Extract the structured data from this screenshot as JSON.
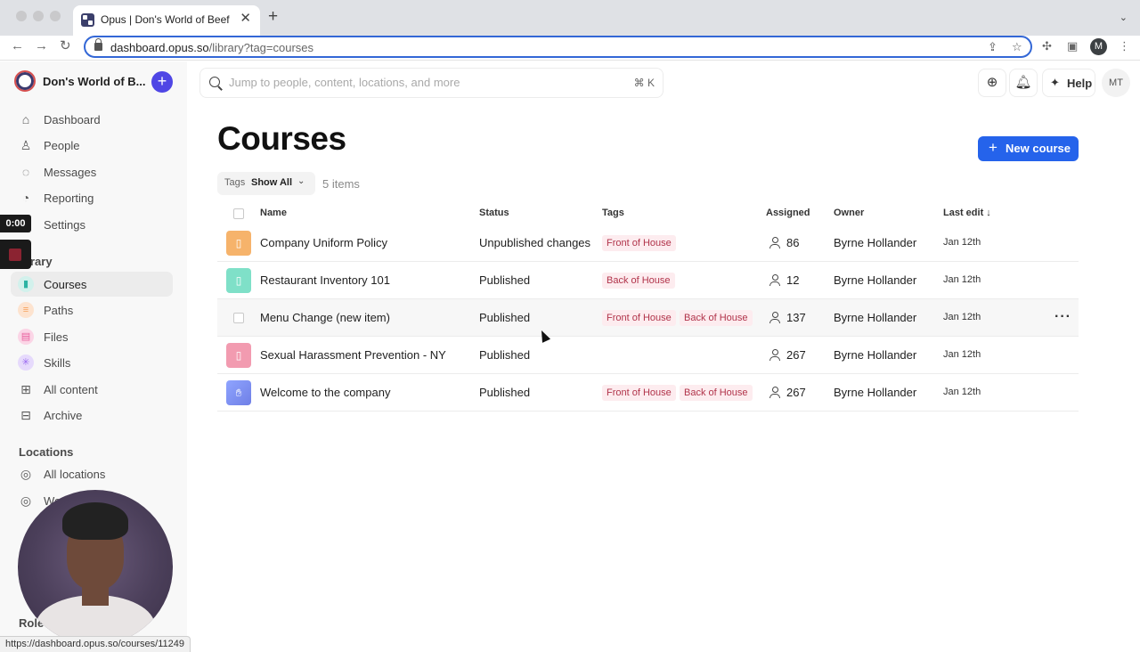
{
  "browser": {
    "tab_title": "Opus | Don's World of Beef",
    "url_host": "dashboard.opus.so",
    "url_path": "/library?tag=courses",
    "profile_initial": "M",
    "status_url": "https://dashboard.opus.so/courses/11249"
  },
  "sidebar": {
    "workspace_name": "Don's World of B...",
    "nav": [
      {
        "label": "Dashboard",
        "icon": "home-icon"
      },
      {
        "label": "People",
        "icon": "person-icon"
      },
      {
        "label": "Messages",
        "icon": "chat-icon"
      },
      {
        "label": "Reporting",
        "icon": "chart-pie-icon"
      },
      {
        "label": "Settings",
        "icon": "gear-icon"
      }
    ],
    "library_label": "rary",
    "library": [
      {
        "label": "Courses",
        "icon": "bookmark-icon",
        "color": "#2bb3a3",
        "active": true
      },
      {
        "label": "Paths",
        "icon": "paths-icon",
        "color": "#f5a15b"
      },
      {
        "label": "Files",
        "icon": "file-icon",
        "color": "#e85d9c"
      },
      {
        "label": "Skills",
        "icon": "sparkle-icon",
        "color": "#9b6cf0"
      },
      {
        "label": "All content",
        "icon": "grid-icon"
      },
      {
        "label": "Archive",
        "icon": "archive-icon"
      }
    ],
    "locations_label": "Locations",
    "locations": [
      {
        "label": "All locations",
        "icon": "location-icon"
      },
      {
        "label": "We",
        "icon": "location-icon"
      }
    ],
    "roles_label": "Role"
  },
  "recording": {
    "timer": "0:00"
  },
  "topbar": {
    "search_placeholder": "Jump to people, content, locations, and more",
    "search_shortcut": "⌘ K",
    "help_label": "Help",
    "user_initials": "MT"
  },
  "main": {
    "title": "Courses",
    "new_button": "New course",
    "filter_key": "Tags",
    "filter_value": "Show All",
    "item_count": "5 items",
    "columns": {
      "name": "Name",
      "status": "Status",
      "tags": "Tags",
      "assigned": "Assigned",
      "owner": "Owner",
      "last_edit": "Last edit"
    },
    "rows": [
      {
        "name": "Company Uniform Policy",
        "status": "Unpublished changes",
        "tags": [
          "Front of House"
        ],
        "assigned": "86",
        "owner": "Byrne Hollander",
        "last_edit": "Jan 12th",
        "icon_color": "#f6b36b"
      },
      {
        "name": "Restaurant Inventory 101",
        "status": "Published",
        "tags": [
          "Back of House"
        ],
        "assigned": "12",
        "owner": "Byrne Hollander",
        "last_edit": "Jan 12th",
        "icon_color": "#7fe0c8"
      },
      {
        "name": "Menu Change (new item)",
        "status": "Published",
        "tags": [
          "Front of House",
          "Back of House"
        ],
        "assigned": "137",
        "owner": "Byrne Hollander",
        "last_edit": "Jan 12th",
        "icon_color": null
      },
      {
        "name": "Sexual Harassment Prevention - NY",
        "status": "Published",
        "tags": [],
        "assigned": "267",
        "owner": "Byrne Hollander",
        "last_edit": "Jan 12th",
        "icon_color": "#f29bb0"
      },
      {
        "name": "Welcome to the company",
        "status": "Published",
        "tags": [
          "Front of House",
          "Back of House"
        ],
        "assigned": "267",
        "owner": "Byrne Hollander",
        "last_edit": "Jan 12th",
        "icon_color": "#7a8cf0"
      }
    ]
  }
}
